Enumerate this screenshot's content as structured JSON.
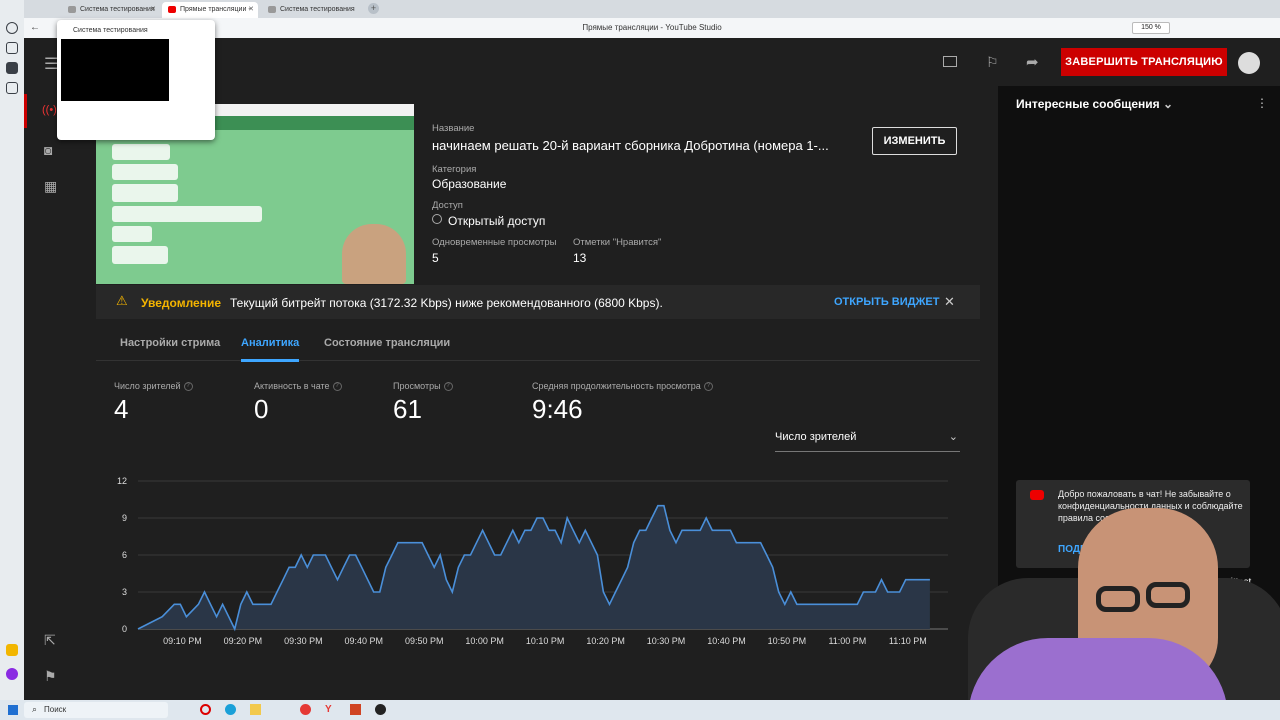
{
  "browser": {
    "tabs": [
      {
        "label": "Система тестирования"
      },
      {
        "label": "Прямые трансляции - "
      },
      {
        "label": "Система тестирования"
      }
    ],
    "page_title": "Прямые трансляции - YouTube Studio",
    "zoom": "150 %"
  },
  "popup": {
    "title": "Система тестирования"
  },
  "header": {
    "end_button": "ЗАВЕРШИТЬ ТРАНСЛЯЦИЮ"
  },
  "stream": {
    "title_label": "Название",
    "title": "начинаем решать 20-й вариант сборника Добротина (номера 1-...",
    "category_label": "Категория",
    "category": "Образование",
    "access_label": "Доступ",
    "access": "Открытый доступ",
    "concurrent_label": "Одновременные просмотры",
    "concurrent": "5",
    "likes_label": "Отметки \"Нравится\"",
    "likes": "13",
    "edit_button": "ИЗМЕНИТЬ"
  },
  "notification": {
    "title": "Уведомление",
    "text": "Текущий битрейт потока (3172.32 Kbps) ниже рекомендованного (6800 Kbps).",
    "action": "ОТКРЫТЬ ВИДЖЕТ"
  },
  "tabs": [
    {
      "label": "Настройки стрима"
    },
    {
      "label": "Аналитика"
    },
    {
      "label": "Состояние трансляции"
    }
  ],
  "metrics": [
    {
      "label": "Число зрителей",
      "value": "4"
    },
    {
      "label": "Активность в чате",
      "value": "0"
    },
    {
      "label": "Просмотры",
      "value": "61"
    },
    {
      "label": "Средняя продолжительность просмотра",
      "value": "9:46"
    }
  ],
  "metric_select": "Число зрителей",
  "chat": {
    "header": "Интересные сообщения",
    "welcome": "Добро пожаловать в чат! Не забывайте о конфиденциальности данных и соблюдайте правила сообщества.",
    "welcome_link": "ПОДРОБНЕЕ",
    "link_fragment": "u/#pst"
  },
  "taskbar": {
    "search": "Поиск"
  },
  "colors": {
    "accent": "#3ea6ff",
    "end_button": "#cc0000",
    "line": "#3f7fcf"
  },
  "chart_data": {
    "type": "area",
    "x_ticks": [
      "09:10 PM",
      "09:20 PM",
      "09:30 PM",
      "09:40 PM",
      "09:50 PM",
      "10:00 PM",
      "10:10 PM",
      "10:20 PM",
      "10:30 PM",
      "10:40 PM",
      "10:50 PM",
      "11:00 PM",
      "11:10 PM"
    ],
    "y_ticks": [
      "0",
      "3",
      "6",
      "9",
      "12"
    ],
    "ylim": [
      0,
      12
    ],
    "grid": true,
    "x_minutes_start": "09:00 PM",
    "series": [
      {
        "values": [
          [
            0,
            0
          ],
          [
            4,
            1
          ],
          [
            6,
            2
          ],
          [
            7,
            2
          ],
          [
            8,
            1
          ],
          [
            10,
            2
          ],
          [
            11,
            3
          ],
          [
            12,
            2
          ],
          [
            13,
            1
          ],
          [
            14,
            2
          ],
          [
            15,
            1
          ],
          [
            16,
            0
          ],
          [
            17,
            2
          ],
          [
            18,
            3
          ],
          [
            19,
            2
          ],
          [
            20,
            2
          ],
          [
            21,
            2
          ],
          [
            22,
            2
          ],
          [
            23,
            3
          ],
          [
            24,
            4
          ],
          [
            25,
            5
          ],
          [
            26,
            5
          ],
          [
            27,
            6
          ],
          [
            28,
            5
          ],
          [
            29,
            6
          ],
          [
            30,
            6
          ],
          [
            31,
            6
          ],
          [
            32,
            5
          ],
          [
            33,
            4
          ],
          [
            34,
            5
          ],
          [
            35,
            6
          ],
          [
            36,
            6
          ],
          [
            37,
            5
          ],
          [
            38,
            4
          ],
          [
            39,
            3
          ],
          [
            40,
            3
          ],
          [
            41,
            5
          ],
          [
            42,
            6
          ],
          [
            43,
            7
          ],
          [
            44,
            7
          ],
          [
            45,
            7
          ],
          [
            46,
            7
          ],
          [
            47,
            7
          ],
          [
            48,
            6
          ],
          [
            49,
            5
          ],
          [
            50,
            6
          ],
          [
            51,
            4
          ],
          [
            52,
            3
          ],
          [
            53,
            5
          ],
          [
            54,
            6
          ],
          [
            55,
            6
          ],
          [
            56,
            7
          ],
          [
            57,
            8
          ],
          [
            58,
            7
          ],
          [
            59,
            6
          ],
          [
            60,
            6
          ],
          [
            61,
            7
          ],
          [
            62,
            8
          ],
          [
            63,
            7
          ],
          [
            64,
            8
          ],
          [
            65,
            8
          ],
          [
            66,
            9
          ],
          [
            67,
            9
          ],
          [
            68,
            8
          ],
          [
            69,
            8
          ],
          [
            70,
            7
          ],
          [
            71,
            9
          ],
          [
            72,
            8
          ],
          [
            73,
            7
          ],
          [
            74,
            8
          ],
          [
            75,
            7
          ],
          [
            76,
            6
          ],
          [
            77,
            3
          ],
          [
            78,
            2
          ],
          [
            79,
            3
          ],
          [
            80,
            4
          ],
          [
            81,
            5
          ],
          [
            82,
            7
          ],
          [
            83,
            8
          ],
          [
            84,
            8
          ],
          [
            85,
            9
          ],
          [
            86,
            10
          ],
          [
            87,
            10
          ],
          [
            88,
            8
          ],
          [
            89,
            7
          ],
          [
            90,
            8
          ],
          [
            91,
            8
          ],
          [
            92,
            8
          ],
          [
            93,
            8
          ],
          [
            94,
            9
          ],
          [
            95,
            8
          ],
          [
            96,
            8
          ],
          [
            97,
            8
          ],
          [
            98,
            8
          ],
          [
            99,
            7
          ],
          [
            100,
            7
          ],
          [
            101,
            7
          ],
          [
            102,
            7
          ],
          [
            103,
            7
          ],
          [
            104,
            6
          ],
          [
            105,
            5
          ],
          [
            106,
            3
          ],
          [
            107,
            2
          ],
          [
            108,
            3
          ],
          [
            109,
            2
          ],
          [
            110,
            2
          ],
          [
            111,
            2
          ],
          [
            112,
            2
          ],
          [
            113,
            2
          ],
          [
            114,
            2
          ],
          [
            115,
            2
          ],
          [
            116,
            2
          ],
          [
            117,
            2
          ],
          [
            118,
            2
          ],
          [
            119,
            2
          ],
          [
            120,
            3
          ],
          [
            121,
            3
          ],
          [
            122,
            3
          ],
          [
            123,
            4
          ],
          [
            124,
            3
          ],
          [
            125,
            3
          ],
          [
            126,
            3
          ],
          [
            127,
            4
          ],
          [
            128,
            4
          ],
          [
            129,
            4
          ],
          [
            130,
            4
          ],
          [
            131,
            4
          ]
        ]
      }
    ]
  }
}
